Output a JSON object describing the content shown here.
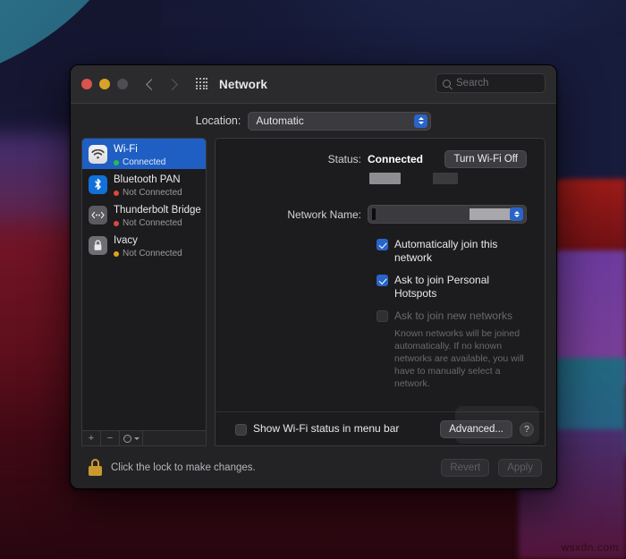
{
  "desktop": {
    "watermark": "wsxdn.com"
  },
  "window": {
    "title": "Network",
    "traffic_lights": [
      "close",
      "minimize",
      "zoom"
    ],
    "nav": {
      "back": "back-chevron",
      "forward": "forward-chevron"
    },
    "grid_icon": "show-all-icon",
    "search": {
      "icon": "search-icon",
      "placeholder": "Search",
      "value": ""
    }
  },
  "location": {
    "label": "Location:",
    "value": "Automatic",
    "options": [
      "Automatic"
    ]
  },
  "sidebar": {
    "services": [
      {
        "name": "Wi-Fi",
        "status": "Connected",
        "status_color": "#2bbd4a",
        "icon": "wifi-icon",
        "selected": true
      },
      {
        "name": "Bluetooth PAN",
        "status": "Not Connected",
        "status_color": "#e0453c",
        "icon": "bluetooth-icon",
        "selected": false
      },
      {
        "name": "Thunderbolt Bridge",
        "status": "Not Connected",
        "status_color": "#e0453c",
        "icon": "thunderbolt-icon",
        "selected": false
      },
      {
        "name": "Ivacy",
        "status": "Not Connected",
        "status_color": "#e0a21f",
        "icon": "lock-icon",
        "selected": false
      }
    ],
    "footer": {
      "add": "+",
      "remove": "−",
      "actions": "gear-icon"
    }
  },
  "main": {
    "status_label": "Status:",
    "status_value": "Connected",
    "toggle_button": "Turn Wi-Fi Off",
    "network_name_label": "Network Name:",
    "network_name_value": "",
    "checkboxes": [
      {
        "label": "Automatically join this network",
        "checked": true,
        "disabled": false
      },
      {
        "label": "Ask to join Personal Hotspots",
        "checked": true,
        "disabled": false
      },
      {
        "label": "Ask to join new networks",
        "checked": false,
        "disabled": true
      }
    ],
    "help_text": "Known networks will be joined automatically. If no known networks are available, you will have to manually select a network.",
    "menu_bar_checkbox": {
      "label": "Show Wi-Fi status in menu bar",
      "checked": false
    },
    "advanced_button": "Advanced...",
    "help_button": "?"
  },
  "footer": {
    "lock_icon": "lock-closed-icon",
    "lock_text": "Click the lock to make changes.",
    "revert_button": "Revert",
    "apply_button": "Apply"
  },
  "colors": {
    "accent": "#2a64c8",
    "selection": "#1f5fc4",
    "window_bg": "#232326",
    "pane_bg": "#1c1c1e"
  }
}
